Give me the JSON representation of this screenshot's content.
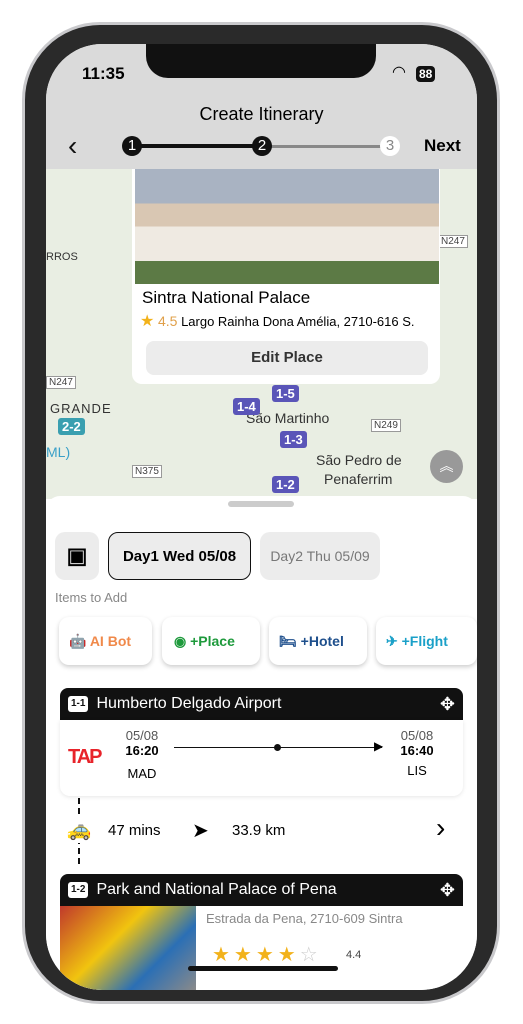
{
  "status": {
    "time": "11:35",
    "battery": "88"
  },
  "header": {
    "title": "Create Itinerary",
    "next": "Next",
    "steps": [
      "1",
      "2",
      "3"
    ],
    "current_step": 2
  },
  "place_card": {
    "name": "Sintra National Palace",
    "rating": "4.5",
    "address": "Largo Rainha Dona Amélia, 2710-616 S.",
    "edit": "Edit Place"
  },
  "map": {
    "labels": [
      "RROS",
      "GRANDE",
      "São Martinho",
      "São Pedro de",
      "Penaferrim",
      "ML)"
    ],
    "roads": [
      "N247",
      "N247",
      "N249",
      "N375"
    ],
    "pins": [
      "1-5",
      "1-4",
      "1-3",
      "1-2",
      "2-2"
    ]
  },
  "days": [
    {
      "label": "Day1 Wed 05/08",
      "selected": true
    },
    {
      "label": "Day2 Thu 05/09",
      "selected": false
    }
  ],
  "items_title": "Items to Add",
  "add_buttons": [
    {
      "label": "AI Bot",
      "color": "#f0894a"
    },
    {
      "label": "+Place",
      "color": "#1e9a3c"
    },
    {
      "label": "+Hotel",
      "color": "#1e4f8c"
    },
    {
      "label": "+Flight",
      "color": "#1aa0c8"
    }
  ],
  "item1": {
    "tag": "1-1",
    "title": "Humberto Delgado Airport",
    "airline": "TAP",
    "dep_date": "05/08",
    "dep_time": "16:20",
    "dep_code": "MAD",
    "arr_date": "05/08",
    "arr_time": "16:40",
    "arr_code": "LIS"
  },
  "transit": {
    "duration": "47 mins",
    "distance": "33.9 km"
  },
  "item2": {
    "tag": "1-2",
    "title": "Park and National Palace of Pena",
    "address": "Estrada da Pena, 2710-609 Sintra",
    "rating": "4.4",
    "stars": 4
  }
}
